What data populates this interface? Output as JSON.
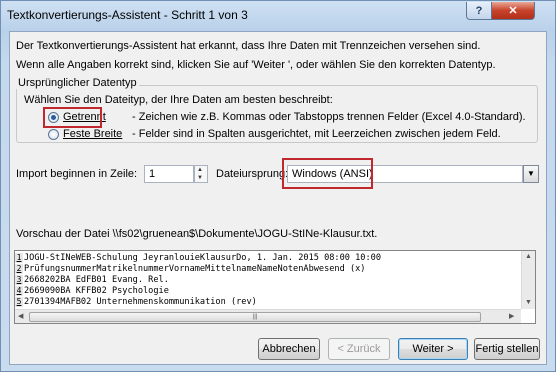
{
  "window": {
    "title": "Textkonvertierungs-Assistent - Schritt 1 von 3",
    "help_label": "?",
    "close_label": "✕"
  },
  "intro": {
    "line1": "Der Textkonvertierungs-Assistent hat erkannt, dass Ihre Daten mit Trennzeichen versehen sind.",
    "line2": "Wenn alle Angaben korrekt sind, klicken Sie auf 'Weiter ', oder wählen Sie den korrekten Datentyp."
  },
  "datatype": {
    "legend": "Ursprünglicher Datentyp",
    "prompt": "Wählen Sie den Dateityp, der Ihre Daten am besten beschreibt:",
    "options": [
      {
        "label": "Getrennt",
        "desc": "- Zeichen wie z.B. Kommas oder Tabstopps trennen Felder (Excel 4.0-Standard).",
        "checked": true
      },
      {
        "label": "Feste Breite",
        "desc": "- Felder sind in Spalten ausgerichtet, mit Leerzeichen zwischen jedem Feld.",
        "checked": false
      }
    ]
  },
  "import": {
    "start_row_label": "Import beginnen in Zeile:",
    "start_row_value": "1",
    "origin_label": "Dateiursprung:",
    "origin_value": "Windows (ANSI)"
  },
  "preview": {
    "label": "Vorschau der Datei \\\\fs02\\gruenean$\\Dokumente\\JOGU-StINe-Klausur.txt.",
    "lines": [
      {
        "num": "1",
        "text": "JOGU-StINeWEB-Schulung JeyranlouieKlausurDo, 1. Jan. 2015 08:00 10:00"
      },
      {
        "num": "2",
        "text": "PrüfungsnummerMatrikelnummerVornameMittelnameNameNotenAbwesend (x)"
      },
      {
        "num": "3",
        "text": "2668202BA EdFB01 Evang. Rel."
      },
      {
        "num": "4",
        "text": "2669090BA KFFB02 Psychologie"
      },
      {
        "num": "5",
        "text": "2701394MAFB02 Unternehmenskommunikation (rev)"
      }
    ]
  },
  "buttons": {
    "cancel": "Abbrechen",
    "back": "< Zurück",
    "next": "Weiter >",
    "finish": "Fertig stellen"
  },
  "colors": {
    "highlight": "#c0282d",
    "accent": "#3c7fb1"
  }
}
